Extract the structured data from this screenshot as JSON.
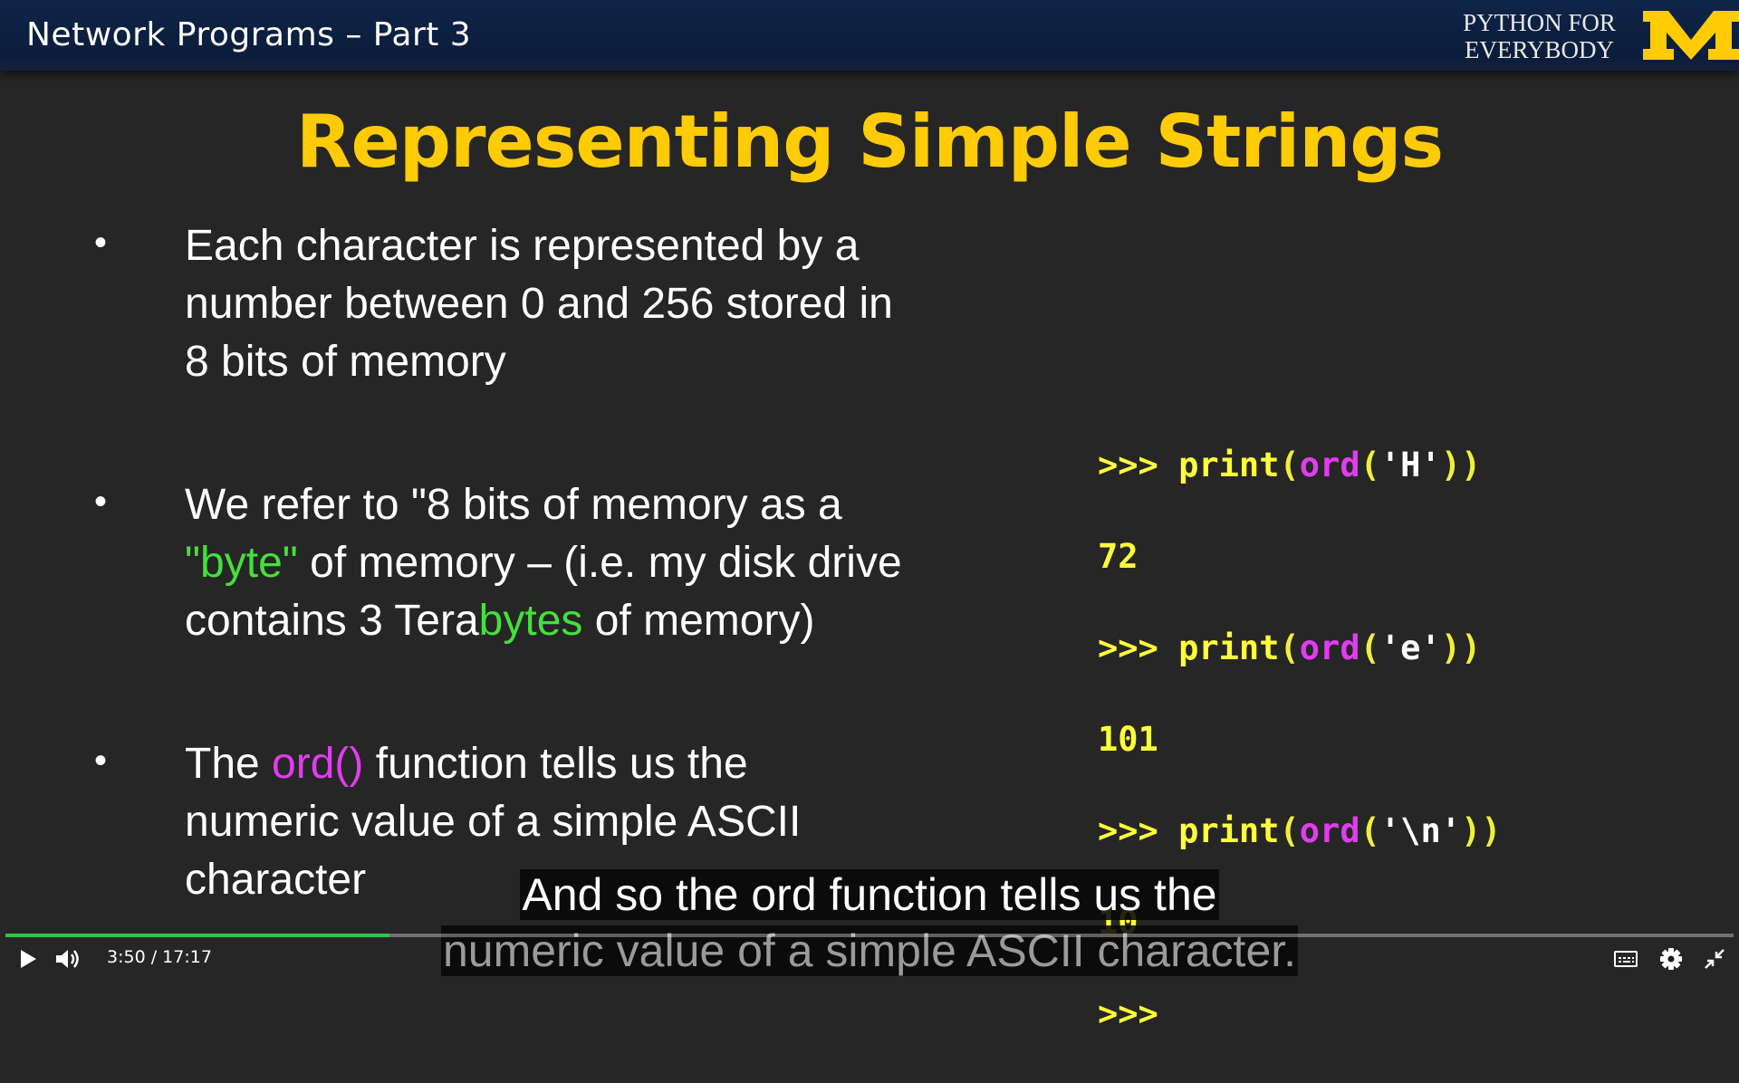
{
  "header": {
    "title": "Network Programs – Part 3",
    "brand_text_line1": "PYTHON FOR",
    "brand_text_line2": "EVERYBODY",
    "logo_letter": "M",
    "logo_color": "#ffcb05"
  },
  "slide": {
    "title": "Representing Simple Strings",
    "bullets": [
      {
        "marker": "•",
        "lines": [
          "Each character is represented by a",
          "number between 0 and 256 stored in",
          "8 bits of memory"
        ]
      },
      {
        "marker": "•",
        "line1": "We refer to \"8 bits of memory as a",
        "line2_hl": "\"byte\"",
        "line2_rest": " of memory – (i.e. my disk drive",
        "line3_a": "contains 3 Tera",
        "line3_hl": "bytes",
        "line3_b": " of memory)"
      },
      {
        "marker": "•",
        "line1_a": "The ",
        "line1_hl": "ord()",
        "line1_b": " function tells us the",
        "line2": "numeric value of a simple ASCII",
        "line3": "character"
      }
    ],
    "code": [
      {
        "prompt": ">>> ",
        "fn": "print",
        "open1": "(",
        "ord": "ord",
        "open2": "(",
        "str": "'H'",
        "close": "))"
      },
      {
        "output": "72"
      },
      {
        "prompt": ">>> ",
        "fn": "print",
        "open1": "(",
        "ord": "ord",
        "open2": "(",
        "str": "'e'",
        "close": "))"
      },
      {
        "output": "101"
      },
      {
        "prompt": ">>> ",
        "fn": "print",
        "open1": "(",
        "ord": "ord",
        "open2": "(",
        "str": "'\\n'",
        "close": "))"
      },
      {
        "output": "10"
      },
      {
        "prompt": ">>>"
      }
    ],
    "colors": {
      "title": "#ffcb05",
      "green_highlight": "#44e03c",
      "pink_highlight": "#e23cf0",
      "code": "#ffff3a"
    }
  },
  "captions": {
    "line1": "And so the ord function tells us the",
    "line2": "numeric value of a simple ASCII character."
  },
  "player": {
    "current_time": "3:50",
    "separator": "/",
    "duration": "17:17",
    "progress_fraction": 0.222,
    "icons": [
      "play-icon",
      "volume-icon",
      "captions-icon",
      "settings-icon",
      "exit-fullscreen-icon"
    ],
    "progress_color": "#2ec64a"
  }
}
